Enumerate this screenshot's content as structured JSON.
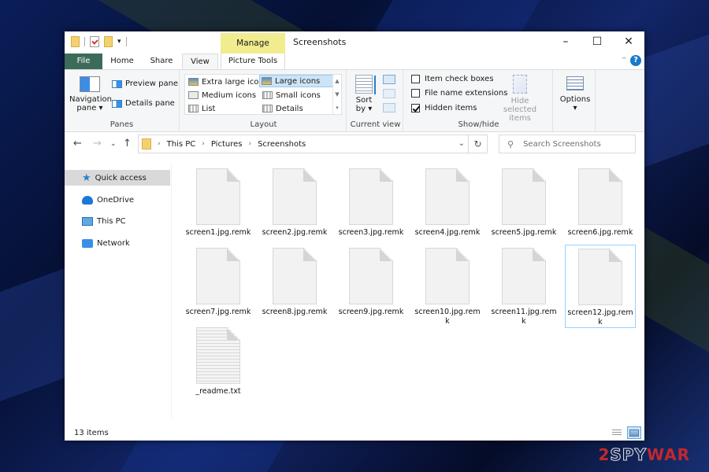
{
  "window": {
    "title": "Screenshots",
    "controls": {
      "minimize": "–",
      "maximize": "☐",
      "close": "✕"
    }
  },
  "ribbon_tabs": {
    "manage": "Manage",
    "file": "File",
    "home": "Home",
    "share": "Share",
    "view": "View",
    "picture_tools": "Picture Tools",
    "active": "View"
  },
  "ribbon": {
    "panes": {
      "label": "Panes",
      "navigation_pane": "Navigation",
      "navigation_pane_2": "pane ▾",
      "preview_pane": "Preview pane",
      "details_pane": "Details pane"
    },
    "layout": {
      "label": "Layout",
      "items": [
        "Extra large icons",
        "Large icons",
        "Medium icons",
        "Small icons",
        "List",
        "Details"
      ],
      "selected": "Large icons"
    },
    "current_view": {
      "label": "Current view",
      "sort_by": "Sort",
      "sort_by_2": "by ▾"
    },
    "show_hide": {
      "label": "Show/hide",
      "item_check_boxes": {
        "label": "Item check boxes",
        "checked": false
      },
      "file_name_extensions": {
        "label": "File name extensions",
        "checked": false
      },
      "hidden_items": {
        "label": "Hidden items",
        "checked": true
      },
      "hide_selected": "Hide selected",
      "hide_selected_2": "items"
    },
    "options": {
      "label": "Options",
      "arrow": "▾"
    }
  },
  "address_bar": {
    "breadcrumbs": [
      "This PC",
      "Pictures",
      "Screenshots"
    ],
    "search_placeholder": "Search Screenshots"
  },
  "sidebar": {
    "items": [
      {
        "label": "Quick access",
        "icon": "star-icon",
        "active": true
      },
      {
        "label": "OneDrive",
        "icon": "cloud-icon",
        "active": false
      },
      {
        "label": "This PC",
        "icon": "computer-icon",
        "active": false
      },
      {
        "label": "Network",
        "icon": "network-icon",
        "active": false
      }
    ]
  },
  "files": [
    {
      "name": "screen1.jpg.remk",
      "type": "blank"
    },
    {
      "name": "screen2.jpg.remk",
      "type": "blank"
    },
    {
      "name": "screen3.jpg.remk",
      "type": "blank"
    },
    {
      "name": "screen4.jpg.remk",
      "type": "blank"
    },
    {
      "name": "screen5.jpg.remk",
      "type": "blank"
    },
    {
      "name": "screen6.jpg.remk",
      "type": "blank"
    },
    {
      "name": "screen7.jpg.remk",
      "type": "blank"
    },
    {
      "name": "screen8.jpg.remk",
      "type": "blank"
    },
    {
      "name": "screen9.jpg.remk",
      "type": "blank"
    },
    {
      "name": "screen10.jpg.remk",
      "type": "blank"
    },
    {
      "name": "screen11.jpg.remk",
      "type": "blank"
    },
    {
      "name": "screen12.jpg.remk",
      "type": "blank",
      "selected": true
    },
    {
      "name": "_readme.txt",
      "type": "text"
    }
  ],
  "status": {
    "item_count": "13 items"
  },
  "watermark": {
    "part1": "2",
    "part2": "SPY",
    "part3": "WAR"
  }
}
